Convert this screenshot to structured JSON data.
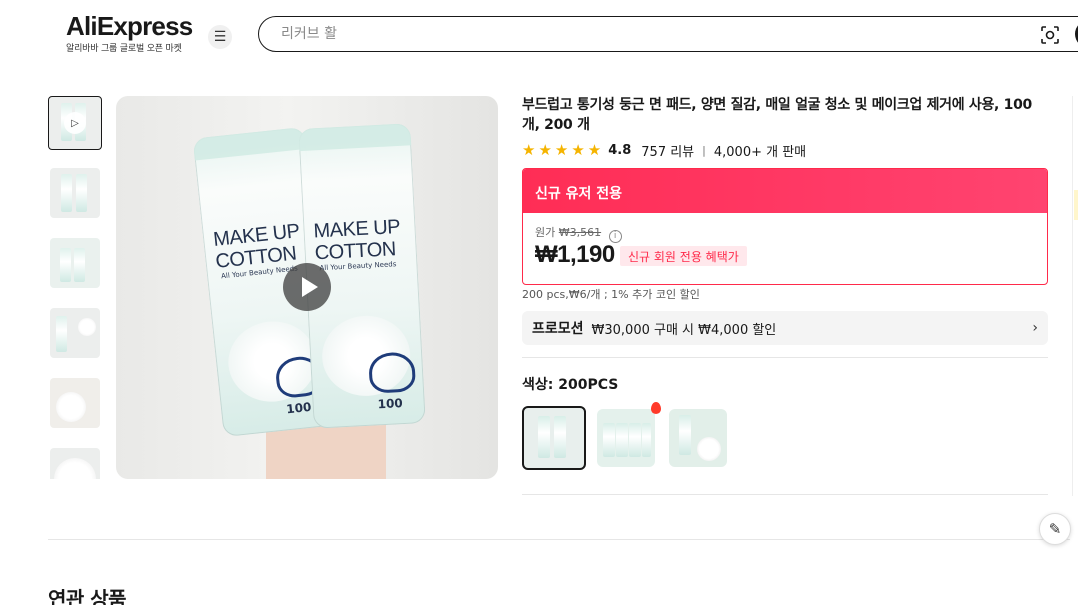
{
  "header": {
    "logo_text": "AliExpress",
    "logo_subtitle": "알리바바 그룹 글로벌 오픈 마켓",
    "search_placeholder": "리커브 활"
  },
  "product": {
    "title": "부드럽고 통기성 둥근 면 패드, 양면 질감, 매일 얼굴 청소 및 메이크업 제거에 사용, 100 개, 200 개",
    "rating": "4.8",
    "reviews": "757 리뷰",
    "sold": "4,000+ 개 판매",
    "image_text": {
      "bag_title": "MAKE UP\nCOTTON",
      "bag_subtitle": "All Your Beauty Needs",
      "bag_count_1": "100",
      "bag_count_2": "100"
    }
  },
  "deal": {
    "header": "신규 유저 전용",
    "original_label": "원가",
    "original_price": "₩3,561",
    "price": "₩1,190",
    "badge": "신규 회원 전용 혜택가",
    "unit_info": "200 pcs,₩6/개 ; 1% 추가 코인 할인"
  },
  "promotion": {
    "title": "프로모션",
    "text": "₩30,000 구매 시 ₩4,000 할인"
  },
  "color": {
    "label": "색상: 200PCS"
  },
  "related": {
    "title": "연관 상품"
  },
  "icons": {
    "menu": "menu-icon",
    "scan": "camera-scan-icon",
    "play": "play-icon",
    "info": "info-icon",
    "chevron": "chevron-right-icon",
    "edit": "pencil-icon",
    "hot": "fire-icon"
  },
  "colors": {
    "accent": "#ff2a4a",
    "star": "#f5b400",
    "logo_accent": "#fd7e14"
  }
}
